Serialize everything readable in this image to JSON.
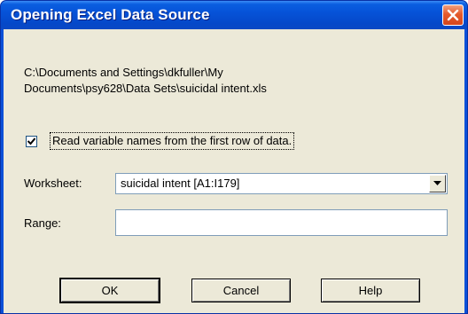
{
  "window": {
    "title": "Opening Excel Data Source"
  },
  "file_path": {
    "line1": "C:\\Documents and Settings\\dkfuller\\My",
    "line2": "Documents\\psy628\\Data Sets\\suicidal intent.xls"
  },
  "read_names": {
    "label": "Read variable names from the first row of data.",
    "checked": true
  },
  "worksheet": {
    "label": "Worksheet:",
    "selected": "suicidal intent  [A1:I179]"
  },
  "range": {
    "label": "Range:",
    "value": ""
  },
  "buttons": {
    "ok": "OK",
    "cancel": "Cancel",
    "help": "Help"
  },
  "colors": {
    "titlebar": "#0653d8",
    "dialog_bg": "#ece9d8",
    "close_button": "#e45a2c"
  }
}
